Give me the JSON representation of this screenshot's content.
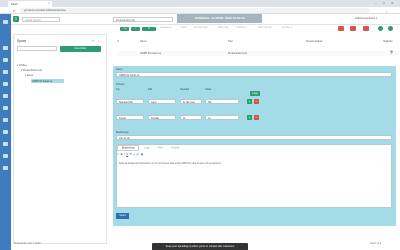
{
  "browser": {
    "tab_title": "Kanzi",
    "url": "gm.kanzi.com/admin/kb/articles/new"
  },
  "app": {
    "search_placeholder": "Global search",
    "top_select": "Productivitet (14)",
    "datebar": "TORSDAG, 16 APRIL 2020 13:04:13",
    "user_select": "Faktureringsenhet 1",
    "toolbar_new": "+ Ny",
    "toolbar_links": [
      "PLANLÄGG",
      "TIDER",
      "AVVIKELSER",
      "FAKTURA",
      "ÖVERSIKT",
      "RAPPORTER",
      "INSTÄLLN"
    ]
  },
  "left_panel": {
    "title": "Space",
    "new_button": "New folder",
    "tree": [
      {
        "label": "All files"
      },
      {
        "label": "Productivitet (14)"
      },
      {
        "label": "Ideas"
      },
      {
        "label": "GDPR för Kanzi.se"
      }
    ]
  },
  "grid": {
    "headers": [
      "",
      "Namn",
      "",
      "Titel",
      "",
      "Senast ändrad",
      "",
      "Åtgärder"
    ],
    "row": [
      "",
      "GDPR för Kanzi.se",
      "",
      "",
      "",
      "Productivitet (14)",
      "",
      ""
    ]
  },
  "form": {
    "name_label": "Namn",
    "name_value": "GDPR för Kanzi.se",
    "criteria_label": "Kriterier",
    "col_headers": [
      "Typ",
      "Fält",
      "Operator",
      "Värde"
    ],
    "add_label": "Lägg",
    "rows": [
      {
        "type": "Standard fält",
        "field": "Land",
        "op": "är lika med",
        "val": "SE"
      },
      {
        "type": "Kunde",
        "field": "Kontakt",
        "op": "Är",
        "val": "Ja"
      }
    ],
    "desc_label": "Beskrivning",
    "desc_value": "Om du vill",
    "editor_tabs": [
      "Beskrivning",
      "Logg",
      "Filer",
      "Historik"
    ],
    "editor_text": "Detta är detaljerad information om hur vi hanterar data enligt GDPR för våra kunder och leverantörer.",
    "submit": "Spara"
  },
  "footer": {
    "left": "Productivitet (14) © 2020",
    "right": "Kanzi v4.0"
  },
  "snackbar": "Keep your spending up when you're in contact with customers"
}
